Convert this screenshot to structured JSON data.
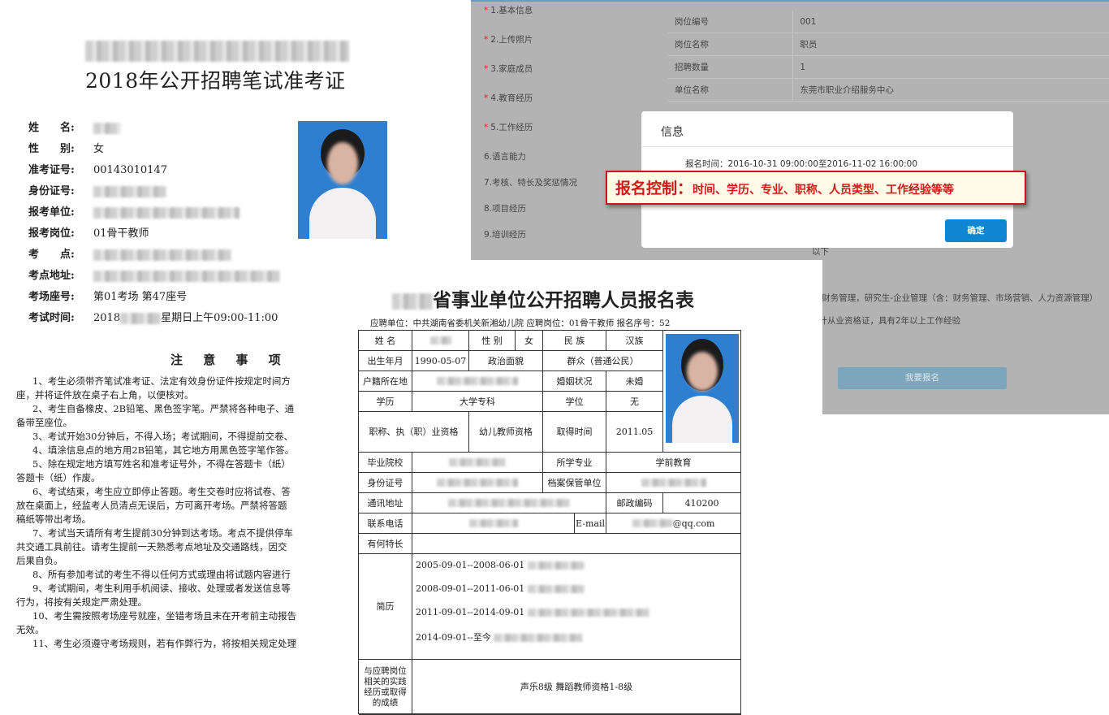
{
  "ticket": {
    "title": "2018年公开招聘笔试准考证",
    "fields": [
      {
        "label": "姓　　名:",
        "value": ""
      },
      {
        "label": "性　　别:",
        "value": "女"
      },
      {
        "label": "准考证号:",
        "value": "00143010147"
      },
      {
        "label": "身份证号:",
        "value": ""
      },
      {
        "label": "报考单位:",
        "value": ""
      },
      {
        "label": "报考岗位:",
        "value": "01骨干教师"
      },
      {
        "label": "考　　点:",
        "value": ""
      },
      {
        "label": "考点地址:",
        "value": ""
      },
      {
        "label": "考场座号:",
        "value": "第01考场  第47座号"
      },
      {
        "label": "考试时间:",
        "value_prefix": "2018",
        "value_suffix": "星期日上午09:00-11:00"
      }
    ],
    "notice_title": "注 意 事 项",
    "notices": [
      "1、考生必须带齐笔试准考证、法定有效身份证件按规定时间方",
      "座，并将证件放在桌子右上角，以便核对。",
      "2、考生自备橡皮、2B铅笔、黑色签字笔。严禁将各种电子、通",
      "备带至座位。",
      "3、考试开始30分钟后，不得入场；考试期间，不得提前交卷、",
      "4、填涂信息点的地方用2B铅笔，其它地方用黑色签字笔作答。",
      "5、除在规定地方填写姓名和准考证号外，不得在答题卡（纸）",
      "答题卡（纸）作废。",
      "6、考试结束，考生应立即停止答题。考生交卷时应将试卷、答",
      "放在桌面上，经监考人员清点无误后，方可离开考场。严禁将答题",
      "稿纸等带出考场。",
      "7、考试当天请所有考生提前30分钟到达考场。考点不提供停车",
      "共交通工具前往。请考生提前一天熟悉考点地址及交通路线，因交",
      "后果自负。",
      "8、所有参加考试的考生不得以任何方式或理由将试题内容进行",
      "9、考试期间，考生利用手机阅读、接收、处理或者发送信息等",
      "行为，将按有关规定严肃处理。",
      "10、考生需按照考场座号就座，坐错考场且未在开考前主动报告",
      "无效。",
      "11、考生必须遵守考场规则，若有作弊行为，将按相关规定处理"
    ]
  },
  "web": {
    "menu": [
      {
        "label": "1.基本信息",
        "required": true
      },
      {
        "label": "2.上传照片",
        "required": true
      },
      {
        "label": "3.家庭成员",
        "required": true
      },
      {
        "label": "4.教育经历",
        "required": true
      },
      {
        "label": "5.工作经历",
        "required": true
      },
      {
        "label": "6.语言能力",
        "required": false
      },
      {
        "label": "7.考核、特长及奖惩情况",
        "required": false
      },
      {
        "label": "8.项目经历",
        "required": false
      },
      {
        "label": "9.培训经历",
        "required": false
      }
    ],
    "rows": [
      {
        "k": "岗位编号",
        "v": "001"
      },
      {
        "k": "岗位名称",
        "v": "职员"
      },
      {
        "k": "招聘数量",
        "v": "1"
      },
      {
        "k": "单位名称",
        "v": "东莞市职业介绍服务中心"
      }
    ],
    "low_text_1": "以下",
    "low_text_2": "生-财务管理，研究生-企业管理（含：财务管理、市场营销、人力资源管理）",
    "low_text_3": "会计从业资格证，具有2年以上工作经验",
    "apply_label": "我要报名",
    "dialog": {
      "title": "信息",
      "time_text": "报名时间：2016-10-31 09:00:00至2016-11-02 16:00:00",
      "ok_label": "确定"
    },
    "callout_main": "报名控制：",
    "callout_detail": "时间、学历、专业、职称、人员类型、工作经验等等"
  },
  "form": {
    "title": "省事业单位公开招聘人员报名表",
    "subtitle": "应聘单位：中共湖南省委机关新湘幼儿院   应聘岗位：01骨干教师     报名序号：52",
    "cells": {
      "name_l": "姓 名",
      "gender_l": "性 别",
      "gender_v": "女",
      "ethnic_l": "民 族",
      "ethnic_v": "汉族",
      "birth_l": "出生年月",
      "birth_v": "1990-05-07",
      "political_l": "政治面貌",
      "political_v": "群众（普通公民）",
      "hukou_l": "户籍所在地",
      "marital_l": "婚姻状况",
      "marital_v": "未婚",
      "edu_l": "学历",
      "edu_v": "大学专科",
      "degree_l": "学位",
      "degree_v": "无",
      "qual_l": "职称、执（职）业资格",
      "qual_v": "幼儿教师资格",
      "obtain_l": "取得时间",
      "obtain_v": "2011.05",
      "school_l": "毕业院校",
      "major_l": "所学专业",
      "major_v": "学前教育",
      "id_l": "身份证号",
      "archive_l": "档案保管单位",
      "addr_l": "通讯地址",
      "zip_l": "邮政编码",
      "zip_v": "410200",
      "phone_l": "联系电话",
      "email_l": "E-mail",
      "email_v": "@qq.com",
      "special_l": "有何特长",
      "resume_l": "简历",
      "achieve_l": "与应聘岗位相关的实践经历或取得的成绩",
      "achieve_v": "声乐8级 舞蹈教师资格1-8级"
    },
    "resume": [
      "2005-09-01--2008-06-01",
      "2008-09-01--2011-06-01",
      "2011-09-01--2014-09-01",
      "2014-09-01--至今"
    ]
  }
}
